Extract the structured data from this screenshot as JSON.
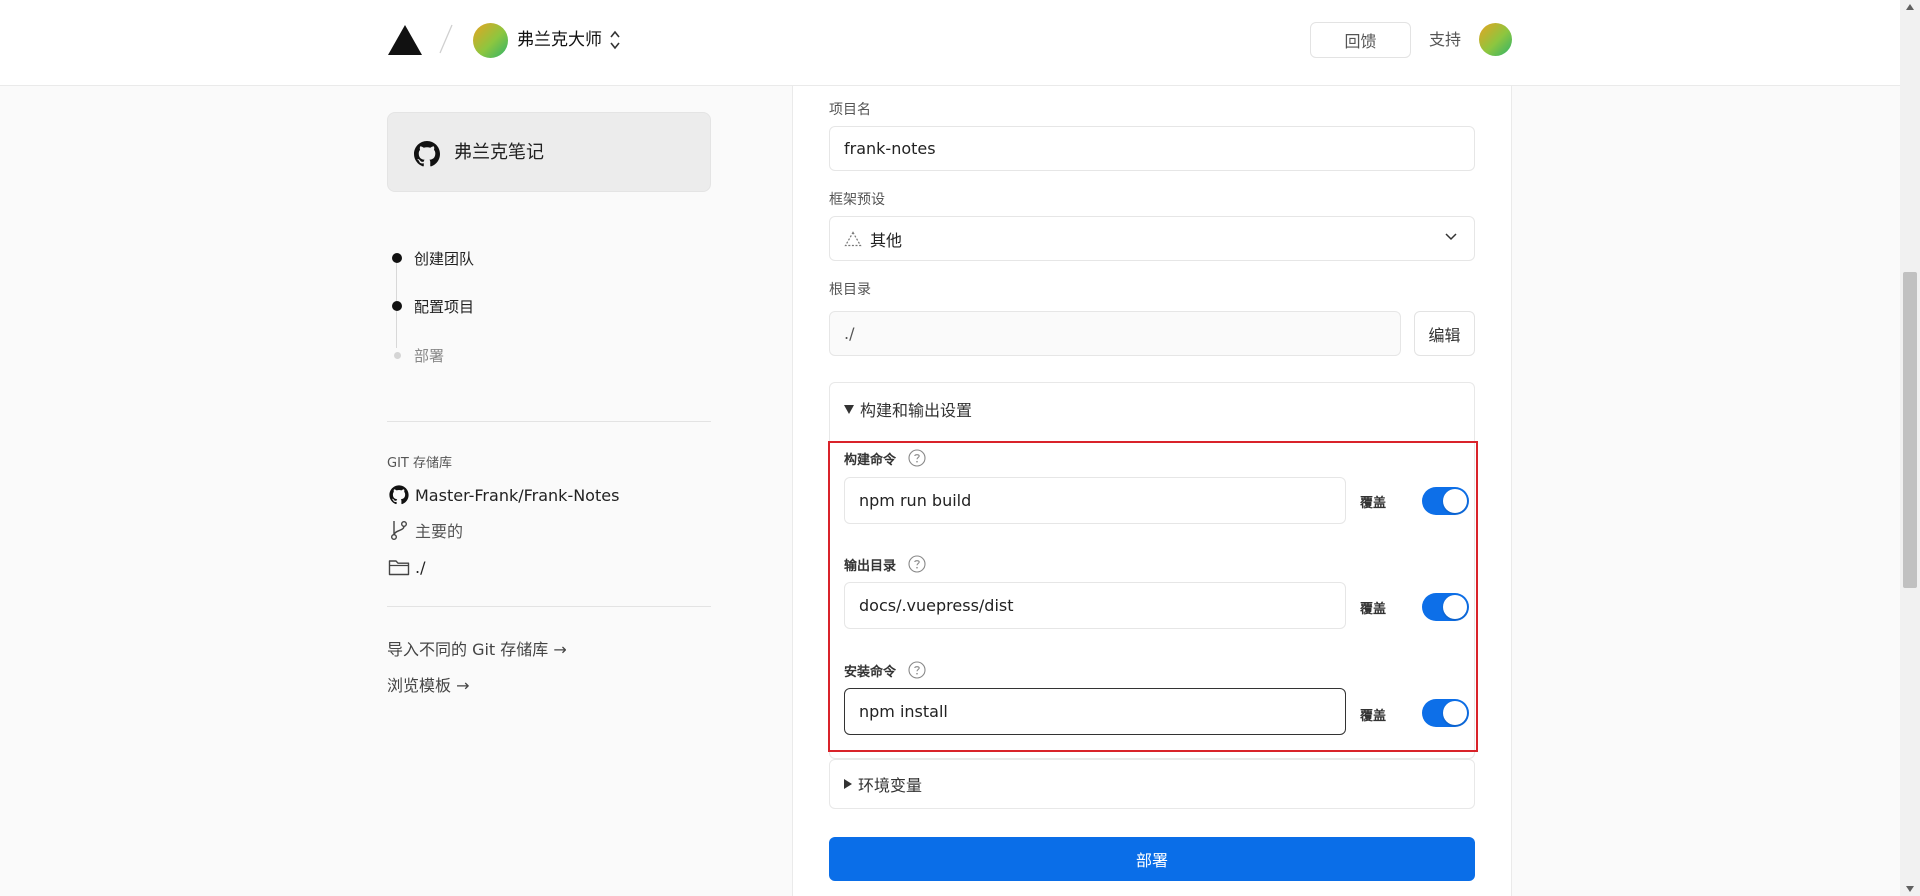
{
  "header": {
    "team_name": "弗兰克大师",
    "feedback_label": "回馈",
    "support_label": "支持"
  },
  "sidebar": {
    "repo_card_name": "弗兰克笔记",
    "steps": [
      {
        "label": "创建团队",
        "state": "done"
      },
      {
        "label": "配置项目",
        "state": "current"
      },
      {
        "label": "部署",
        "state": "pending"
      }
    ],
    "git_title": "GIT 存储库",
    "repo_full_name": "Master-Frank/Frank-Notes",
    "branch": "主要的",
    "root_path": "./",
    "import_link": "导入不同的 Git 存储库 →",
    "browse_link": "浏览模板 →"
  },
  "form": {
    "project_name_label": "项目名",
    "project_name_value": "frank-notes",
    "framework_label": "框架预设",
    "framework_value": "其他",
    "root_dir_label": "根目录",
    "root_dir_value": "./",
    "edit_label": "编辑",
    "build_section_title": "构建和输出设置",
    "build_command_label": "构建命令",
    "build_command_value": "npm run build",
    "output_dir_label": "输出目录",
    "output_dir_value": "docs/.vuepress/dist",
    "install_command_label": "安装命令",
    "install_command_value": "npm install",
    "override_label": "覆盖",
    "env_section_title": "环境变量",
    "deploy_label": "部署"
  },
  "colors": {
    "accent": "#0a6ee8",
    "highlight_border": "#d9232a"
  }
}
